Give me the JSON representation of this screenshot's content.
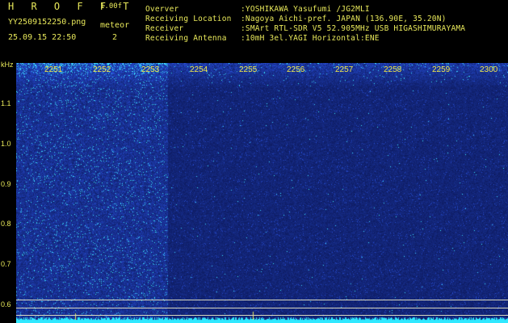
{
  "header": {
    "app_name": "H R O F F T",
    "version": "1.00f",
    "file_name": "YY2509152250.png",
    "meteor_label": "meteor",
    "meteor_count": "2",
    "datetime": "25.09.15 22:50",
    "info": [
      {
        "label": "Overver",
        "value": ":YOSHIKAWA Yasufumi /JG2MLI"
      },
      {
        "label": "Receiving Location",
        "value": ":Nagoya Aichi-pref. JAPAN (136.90E, 35.20N)"
      },
      {
        "label": "Receiver",
        "value": ":SMArt RTL-SDR V5 52.905MHz USB HIGASHIMURAYAMA"
      },
      {
        "label": "Receiving Antenna",
        "value": ":10mH 3el.YAGI Horizontal:ENE"
      }
    ]
  },
  "y_axis": {
    "unit": "kHz",
    "ticks": [
      "1.1",
      "1.0",
      "0.9",
      "0.8",
      "0.7",
      "0.6"
    ]
  },
  "time_marks": [
    "2251",
    "2252",
    "2253",
    "2254",
    "2255",
    "2256",
    "2257",
    "2258",
    "2259",
    "2300"
  ],
  "colors": {
    "text": "#e8e85a",
    "background_noise": "#0a1478",
    "signal": "#40e8ff"
  }
}
